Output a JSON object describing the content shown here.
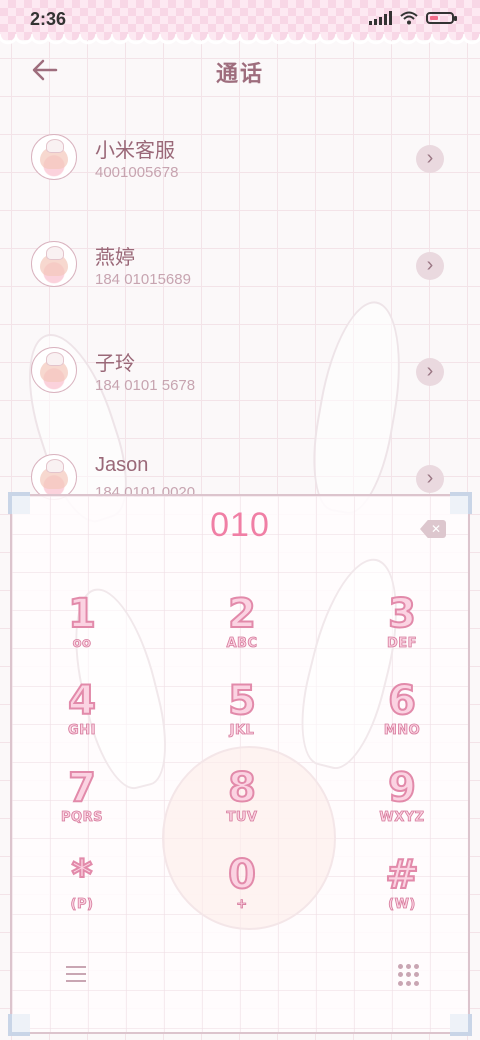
{
  "status_bar": {
    "time": "2:36"
  },
  "header": {
    "title": "通话",
    "back_icon": "arrow-left-icon"
  },
  "contacts": [
    {
      "name": "小米客服",
      "number": "4001005678"
    },
    {
      "name": "燕婷",
      "number": "184 01015689"
    },
    {
      "name": "子玲",
      "number": "184 0101 5678"
    },
    {
      "name": "Jason",
      "number": "184 0101 0020"
    }
  ],
  "dialer": {
    "display": "010",
    "keys": [
      {
        "digit": "1",
        "letters": "oo"
      },
      {
        "digit": "2",
        "letters": "ABC"
      },
      {
        "digit": "3",
        "letters": "DEF"
      },
      {
        "digit": "4",
        "letters": "GHI"
      },
      {
        "digit": "5",
        "letters": "JKL"
      },
      {
        "digit": "6",
        "letters": "MNO"
      },
      {
        "digit": "7",
        "letters": "PQRS"
      },
      {
        "digit": "8",
        "letters": "TUV"
      },
      {
        "digit": "9",
        "letters": "WXYZ"
      },
      {
        "digit": "*",
        "letters": "(P)"
      },
      {
        "digit": "0",
        "letters": "+"
      },
      {
        "digit": "#",
        "letters": "(W)"
      }
    ]
  },
  "colors": {
    "accent": "#f07fa5",
    "title": "#9e6d7d",
    "grid": "#f3e3e8"
  }
}
